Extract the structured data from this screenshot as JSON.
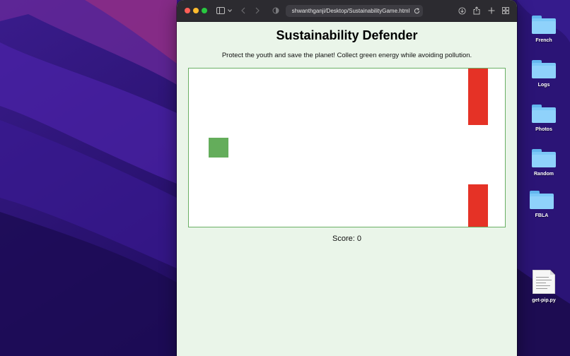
{
  "browser": {
    "url": "shwanthganji/Desktop/SustainabilityGame.html"
  },
  "page": {
    "title": "Sustainability Defender",
    "subtitle": "Protect the youth and save the planet! Collect green energy while avoiding pollution.",
    "score_text": "Score: 0"
  },
  "game": {
    "colors": {
      "player": "#64ad5b",
      "obstacle": "#e53226",
      "border": "#6aaf64"
    }
  },
  "desktop": {
    "items": [
      {
        "label": "French",
        "icon": "folder-icon"
      },
      {
        "label": "Logs",
        "icon": "folder-icon"
      },
      {
        "label": "Photos",
        "icon": "folder-icon"
      },
      {
        "label": "Random",
        "icon": "folder-icon"
      },
      {
        "label": "FBLA",
        "icon": "folder-icon"
      },
      {
        "label": "get-pip.py",
        "icon": "python-file-icon"
      }
    ]
  }
}
